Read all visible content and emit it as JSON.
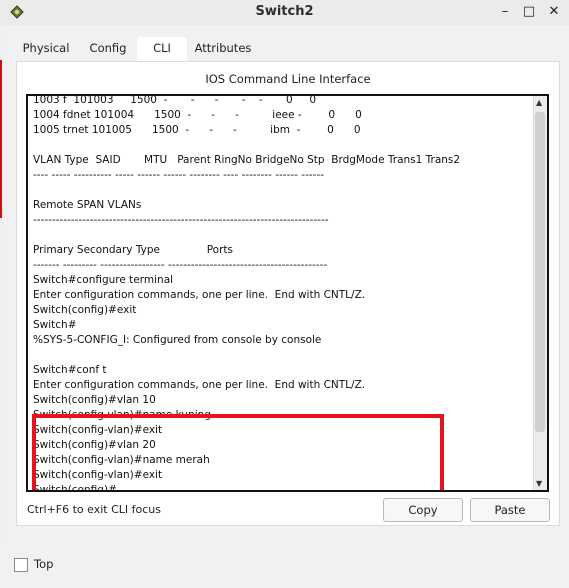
{
  "window": {
    "title": "Switch2",
    "minimize_glyph": "–",
    "maximize_glyph": "□",
    "close_glyph": "✕"
  },
  "tabs": [
    {
      "label": "Physical"
    },
    {
      "label": "Config"
    },
    {
      "label": "CLI"
    },
    {
      "label": "Attributes"
    }
  ],
  "active_tab": "CLI",
  "panel": {
    "title": "IOS Command Line Interface"
  },
  "terminal": {
    "lines": [
      "1003 f  101003     1500  -       -      -       -    -       0     0",
      "1004 fdnet 101004      1500  -      -      -          ieee -        0      0",
      "1005 trnet 101005      1500  -      -      -          ibm  -        0      0",
      "",
      "VLAN Type  SAID       MTU   Parent RingNo BridgeNo Stp  BrdgMode Trans1 Trans2",
      "---- ----- ---------- ----- ------ ------ -------- ---- -------- ------ ------",
      "",
      "Remote SPAN VLANs",
      "------------------------------------------------------------------------------",
      "",
      "Primary Secondary Type              Ports",
      "------- --------- ----------------- ------------------------------------------",
      "Switch#configure terminal",
      "Enter configuration commands, one per line.  End with CNTL/Z.",
      "Switch(config)#exit",
      "Switch#",
      "%SYS-5-CONFIG_I: Configured from console by console",
      "",
      "Switch#conf t",
      "Enter configuration commands, one per line.  End with CNTL/Z.",
      "Switch(config)#vlan 10",
      "Switch(config-vlan)#name kuning",
      "Switch(config-vlan)#exit",
      "Switch(config)#vlan 20",
      "Switch(config-vlan)#name merah",
      "Switch(config-vlan)#exit",
      "Switch(config)#"
    ]
  },
  "hint": "Ctrl+F6 to exit CLI focus",
  "buttons": {
    "copy": "Copy",
    "paste": "Paste"
  },
  "top_checkbox": {
    "label": "Top",
    "checked": false
  },
  "colors": {
    "highlight": "#e4141c",
    "tab_underline": "#3d8fd0"
  }
}
